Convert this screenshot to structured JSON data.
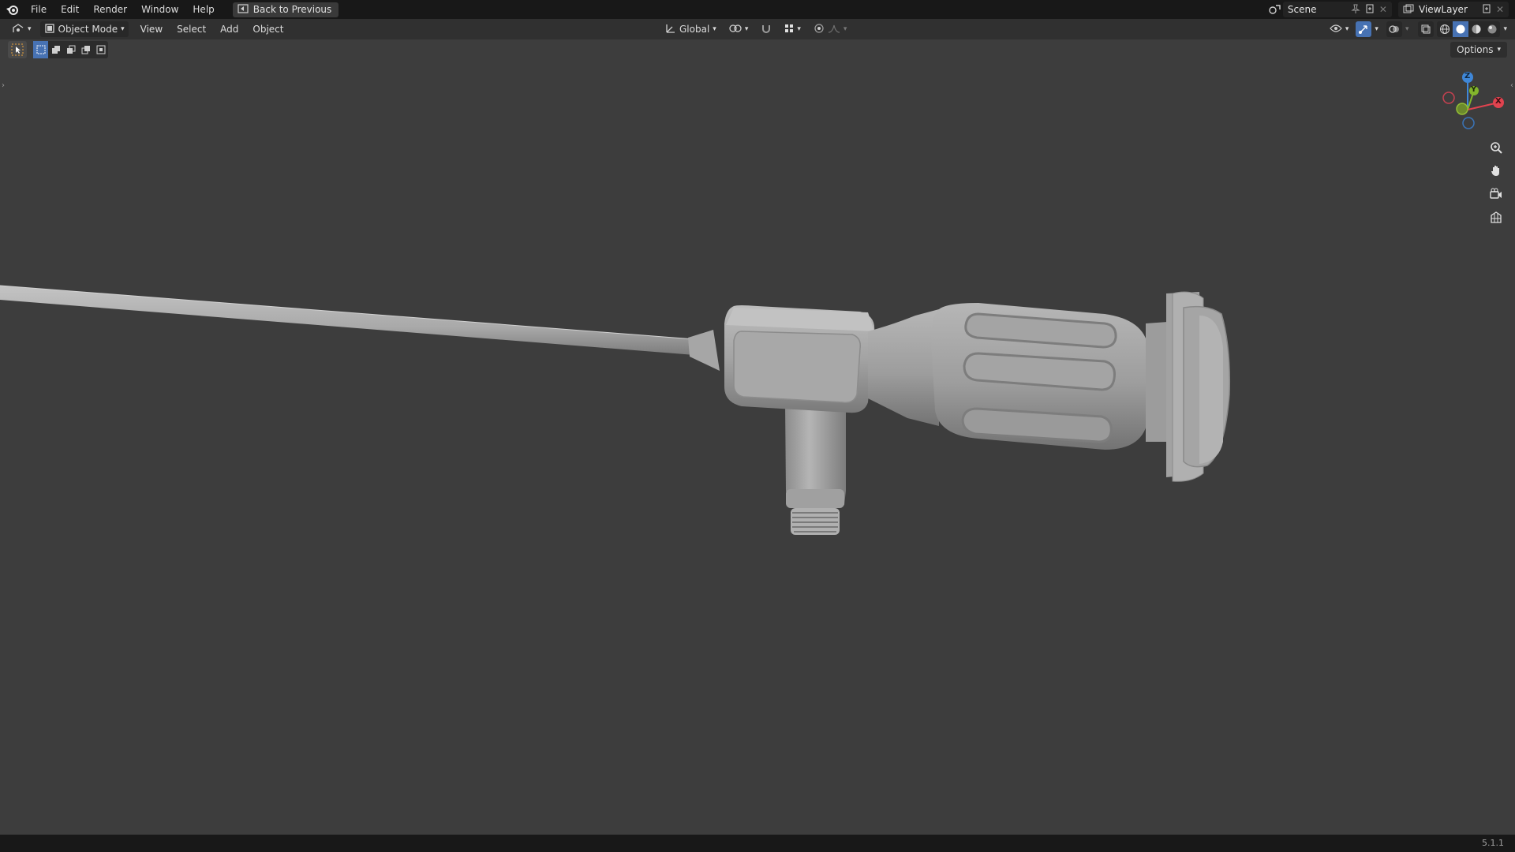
{
  "menu": {
    "file": "File",
    "edit": "Edit",
    "render": "Render",
    "window": "Window",
    "help": "Help",
    "back_to_previous": "Back to Previous"
  },
  "scene": {
    "name": "Scene"
  },
  "view_layer": {
    "name": "ViewLayer"
  },
  "viewport_header": {
    "mode": "Object Mode",
    "view": "View",
    "select": "Select",
    "add": "Add",
    "object": "Object",
    "orientation": "Global"
  },
  "options": {
    "label": "Options"
  },
  "gizmo": {
    "z": "Z",
    "y": "Y",
    "x": "X"
  },
  "colors": {
    "accent": "#4772b3",
    "axis_x": "#e1434f",
    "axis_y": "#82b52c",
    "axis_z": "#3f87d8",
    "viewport_bg": "#3d3d3d"
  },
  "icons": {
    "logo": "blender-logo-icon",
    "select_tool": "select-box-tool-icon",
    "zoom": "zoom-icon",
    "pan": "hand-icon",
    "camera": "camera-icon",
    "ortho": "grid-icon"
  },
  "status": {
    "version": "5.1.1"
  }
}
